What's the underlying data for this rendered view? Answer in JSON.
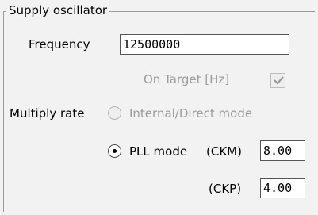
{
  "group": {
    "title": "Supply oscillator"
  },
  "frequency": {
    "label": "Frequency",
    "value": "12500000"
  },
  "on_target": {
    "label": "On Target [Hz]",
    "checked": true,
    "enabled": false
  },
  "multiply": {
    "label": "Multiply rate",
    "internal_label": "Internal/Direct mode",
    "internal_selected": false,
    "pll_label": "PLL mode",
    "pll_selected": true
  },
  "ckm": {
    "label": "(CKM)",
    "value": "8.00"
  },
  "ckp": {
    "label": "(CKP)",
    "value": "4.00"
  }
}
